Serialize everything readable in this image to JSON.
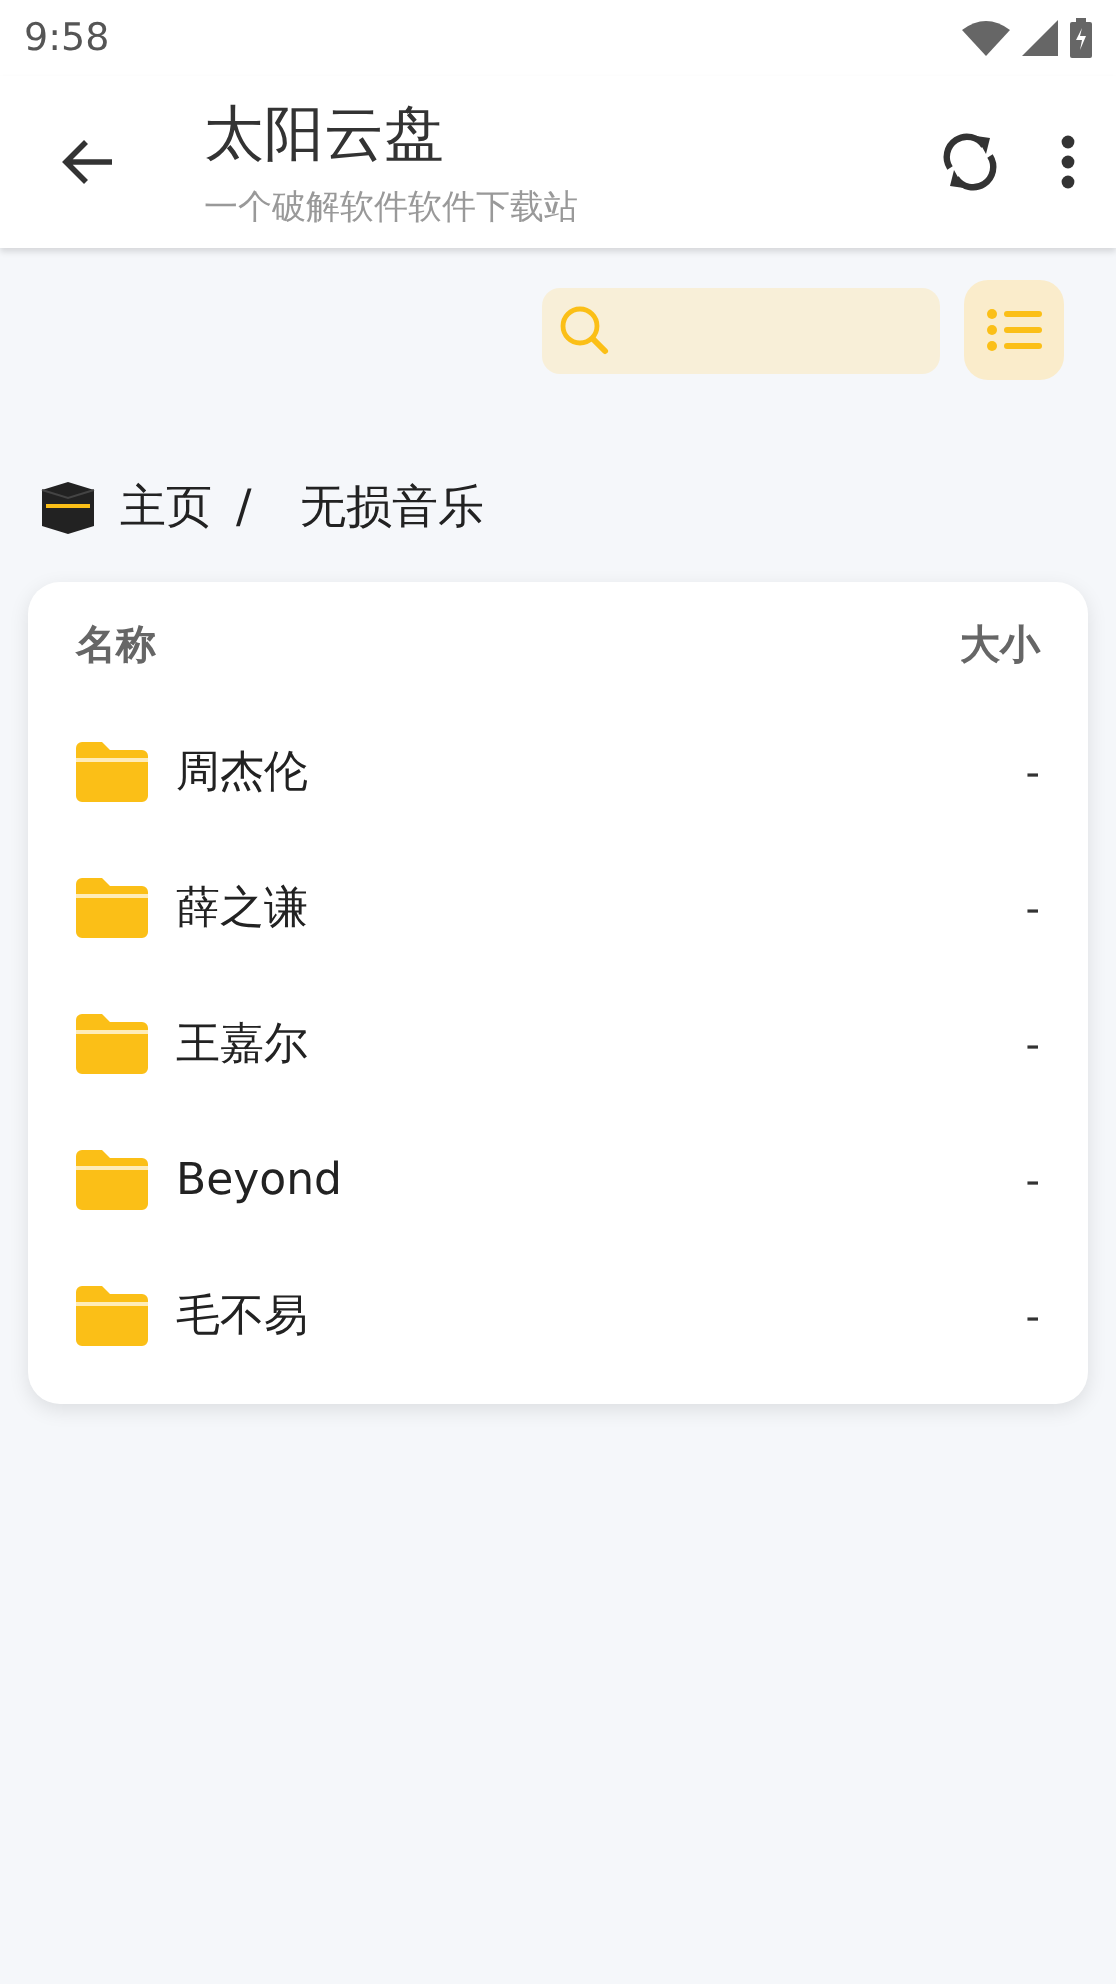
{
  "status_bar": {
    "time": "9:58"
  },
  "app_bar": {
    "title": "太阳云盘",
    "subtitle": "一个破解软件软件下载站"
  },
  "breadcrumb": [
    {
      "label": "主页"
    },
    {
      "label": "/"
    },
    {
      "label": "无损音乐"
    }
  ],
  "table": {
    "columns": [
      "名称",
      "大小"
    ],
    "rows": [
      {
        "name": "周杰伦",
        "size": "-"
      },
      {
        "name": "薛之谦",
        "size": "-"
      },
      {
        "name": "王嘉尔",
        "size": "-"
      },
      {
        "name": "Beyond",
        "size": "-"
      },
      {
        "name": "毛不易",
        "size": "-"
      }
    ]
  }
}
